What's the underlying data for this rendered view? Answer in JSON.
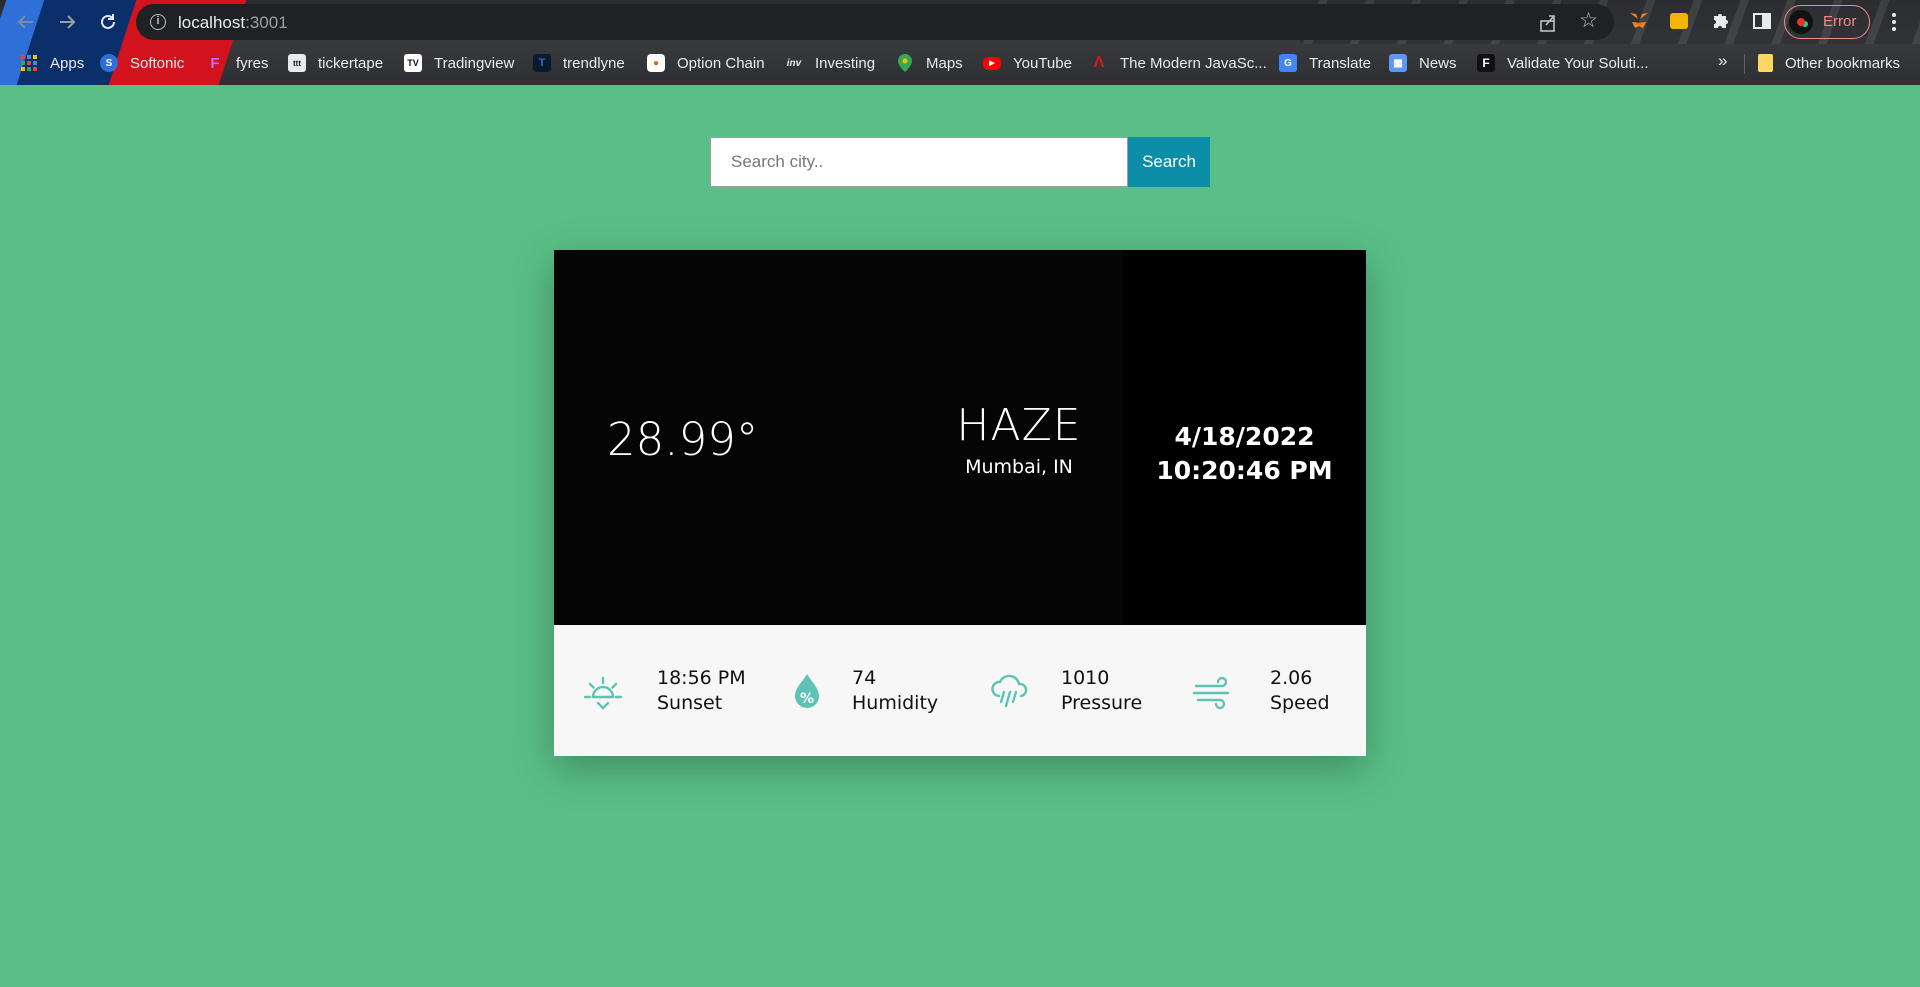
{
  "browser": {
    "url_host": "localhost",
    "url_port": ":3001",
    "profile_label": "Error",
    "bookmarks": [
      {
        "label": "Apps",
        "icon": "apps-grid-icon"
      },
      {
        "label": "Softonic",
        "icon": "softonic-icon"
      },
      {
        "label": "fyres",
        "icon": "fyres-icon"
      },
      {
        "label": "tickertape",
        "icon": "tickertape-icon"
      },
      {
        "label": "Tradingview",
        "icon": "tradingview-icon"
      },
      {
        "label": "trendlyne",
        "icon": "trendlyne-icon"
      },
      {
        "label": "Option Chain",
        "icon": "option-chain-icon"
      },
      {
        "label": "Investing",
        "icon": "investing-icon"
      },
      {
        "label": "Maps",
        "icon": "maps-icon"
      },
      {
        "label": "YouTube",
        "icon": "youtube-icon"
      },
      {
        "label": "The Modern JavaSc...",
        "icon": "javascript-info-icon"
      },
      {
        "label": "Translate",
        "icon": "translate-icon"
      },
      {
        "label": "News",
        "icon": "news-icon"
      },
      {
        "label": "Validate Your Soluti...",
        "icon": "validate-icon"
      }
    ],
    "bookmarks_more": "»",
    "other_bookmarks": "Other bookmarks"
  },
  "search": {
    "placeholder": "Search city..",
    "button_label": "Search"
  },
  "weather": {
    "temperature": "28.99°",
    "condition": "HAZE",
    "location": "Mumbai, IN",
    "date": "4/18/2022",
    "time": "10:20:46 PM"
  },
  "stats": [
    {
      "value": "18:56 PM",
      "label": "Sunset",
      "icon": "sunset-icon"
    },
    {
      "value": "74",
      "label": "Humidity",
      "icon": "humidity-icon"
    },
    {
      "value": "1010",
      "label": "Pressure",
      "icon": "rain-cloud-icon"
    },
    {
      "value": "2.06",
      "label": "Speed",
      "icon": "wind-icon"
    }
  ],
  "colors": {
    "page_bg": "#59bf86",
    "search_button": "#0a8ea8",
    "card_dark": "#050505",
    "stat_icon": "#5ec3b4"
  }
}
